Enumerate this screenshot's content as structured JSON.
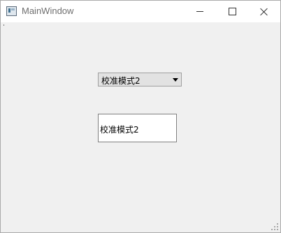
{
  "window": {
    "title": "MainWindow",
    "app_icon": "qt-window-icon",
    "controls": [
      "minimize-icon",
      "maximize-icon",
      "close-icon"
    ]
  },
  "combo": {
    "selected": "校准模式2",
    "arrow_icon": "dropdown-arrow-icon"
  },
  "label": {
    "text": "校准模式2"
  },
  "colors": {
    "client_background": "#f0f0f0",
    "titlebar": "#ffffff",
    "combo_background": "#e2e2e2"
  }
}
